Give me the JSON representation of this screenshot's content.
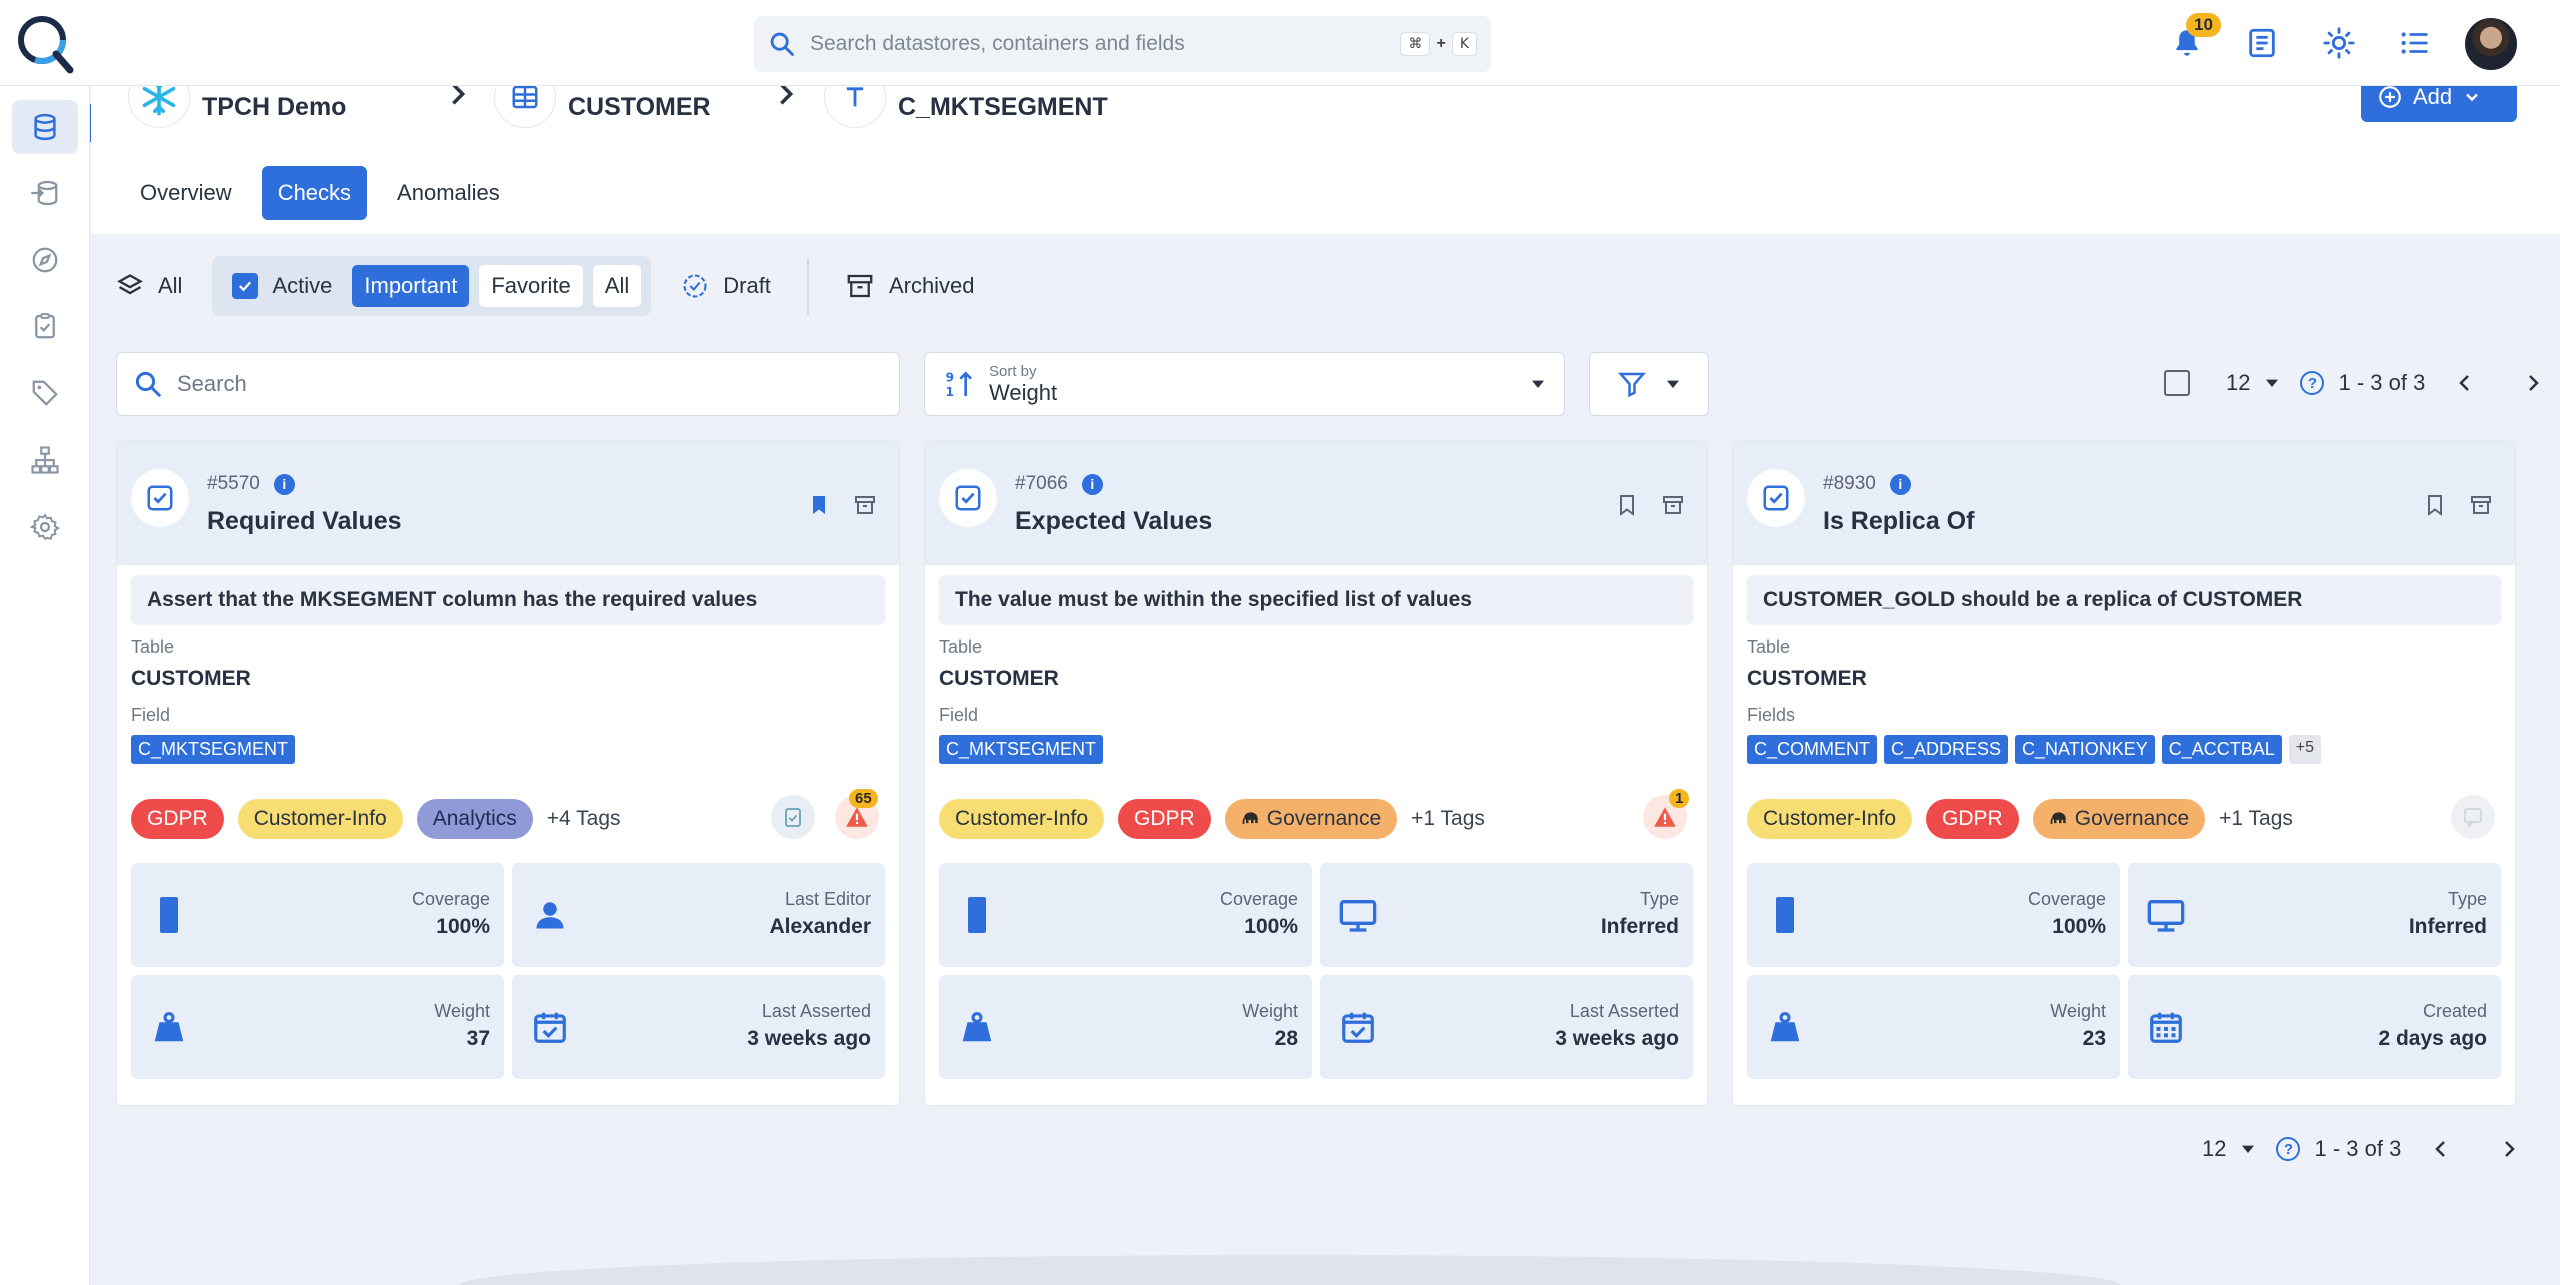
{
  "search": {
    "placeholder": "Search datastores, containers and fields",
    "shortcut_cmd": "⌘",
    "shortcut_plus": "+",
    "shortcut_key": "K"
  },
  "notifications": {
    "count": "10"
  },
  "breadcrumb": [
    {
      "label": "TPCH Demo",
      "icon": "snowflake-icon"
    },
    {
      "label": "CUSTOMER",
      "icon": "table-icon"
    },
    {
      "label": "C_MKTSEGMENT",
      "icon": "text-field-icon"
    }
  ],
  "add_button": {
    "label": "Add"
  },
  "tabs": [
    {
      "label": "Overview"
    },
    {
      "label": "Checks",
      "active": true
    },
    {
      "label": "Anomalies"
    }
  ],
  "filters": {
    "all": "All",
    "active": "Active",
    "important": "Important",
    "favorite": "Favorite",
    "all_sub": "All",
    "draft": "Draft",
    "archived": "Archived"
  },
  "list_search": {
    "placeholder": "Search"
  },
  "sort": {
    "label": "Sort by",
    "value": "Weight"
  },
  "pagination": {
    "per_page": "12",
    "range": "1 - 3 of 3"
  },
  "cards": [
    {
      "id": "#5570",
      "title": "Required Values",
      "bookmarked": true,
      "description": "Assert that the MKSEGMENT column has the required values",
      "table_label": "Table",
      "table": "CUSTOMER",
      "field_label": "Field",
      "fields": [
        "C_MKTSEGMENT"
      ],
      "tags": [
        {
          "label": "GDPR",
          "color": "#ef4b4b"
        },
        {
          "label": "Customer-Info",
          "color": "#f7dd72"
        },
        {
          "label": "Analytics",
          "color": "#8f9ad6"
        }
      ],
      "more_tags": "+4 Tags",
      "anomaly_count": "65",
      "stats": [
        {
          "label": "Coverage",
          "value": "100%",
          "icon": "coverage-bar-icon"
        },
        {
          "label": "Last Editor",
          "value": "Alexander",
          "icon": "person-icon"
        },
        {
          "label": "Weight",
          "value": "37",
          "icon": "weight-icon"
        },
        {
          "label": "Last Asserted",
          "value": "3 weeks ago",
          "icon": "calendar-check-icon"
        }
      ]
    },
    {
      "id": "#7066",
      "title": "Expected Values",
      "bookmarked": false,
      "description": "The value must be within the specified list of values",
      "table_label": "Table",
      "table": "CUSTOMER",
      "field_label": "Field",
      "fields": [
        "C_MKTSEGMENT"
      ],
      "tags": [
        {
          "label": "Customer-Info",
          "color": "#f7dd72"
        },
        {
          "label": "GDPR",
          "color": "#ef4b4b"
        },
        {
          "label": "Governance",
          "color": "#f5b06a"
        }
      ],
      "more_tags": "+1 Tags",
      "anomaly_count": "1",
      "stats": [
        {
          "label": "Coverage",
          "value": "100%",
          "icon": "coverage-bar-icon"
        },
        {
          "label": "Type",
          "value": "Inferred",
          "icon": "monitor-icon"
        },
        {
          "label": "Weight",
          "value": "28",
          "icon": "weight-icon"
        },
        {
          "label": "Last Asserted",
          "value": "3 weeks ago",
          "icon": "calendar-check-icon"
        }
      ]
    },
    {
      "id": "#8930",
      "title": "Is Replica Of",
      "bookmarked": false,
      "description": "CUSTOMER_GOLD should be a replica of CUSTOMER",
      "table_label": "Table",
      "table": "CUSTOMER",
      "field_label": "Fields",
      "fields": [
        "C_COMMENT",
        "C_ADDRESS",
        "C_NATIONKEY",
        "C_ACCTBAL"
      ],
      "more_fields": "+5",
      "tags": [
        {
          "label": "Customer-Info",
          "color": "#f7dd72"
        },
        {
          "label": "GDPR",
          "color": "#ef4b4b"
        },
        {
          "label": "Governance",
          "color": "#f5b06a"
        }
      ],
      "more_tags": "+1 Tags",
      "stats": [
        {
          "label": "Coverage",
          "value": "100%",
          "icon": "coverage-bar-icon"
        },
        {
          "label": "Type",
          "value": "Inferred",
          "icon": "monitor-icon"
        },
        {
          "label": "Weight",
          "value": "23",
          "icon": "weight-icon"
        },
        {
          "label": "Created",
          "value": "2 days ago",
          "icon": "calendar-icon"
        }
      ]
    }
  ],
  "colors": {
    "accent": "#2f6fdb",
    "gdpr": "#ef4b4b",
    "customer_info": "#f7dd72",
    "analytics": "#8f9ad6",
    "governance": "#f5b06a",
    "badge": "#f6b51e"
  }
}
